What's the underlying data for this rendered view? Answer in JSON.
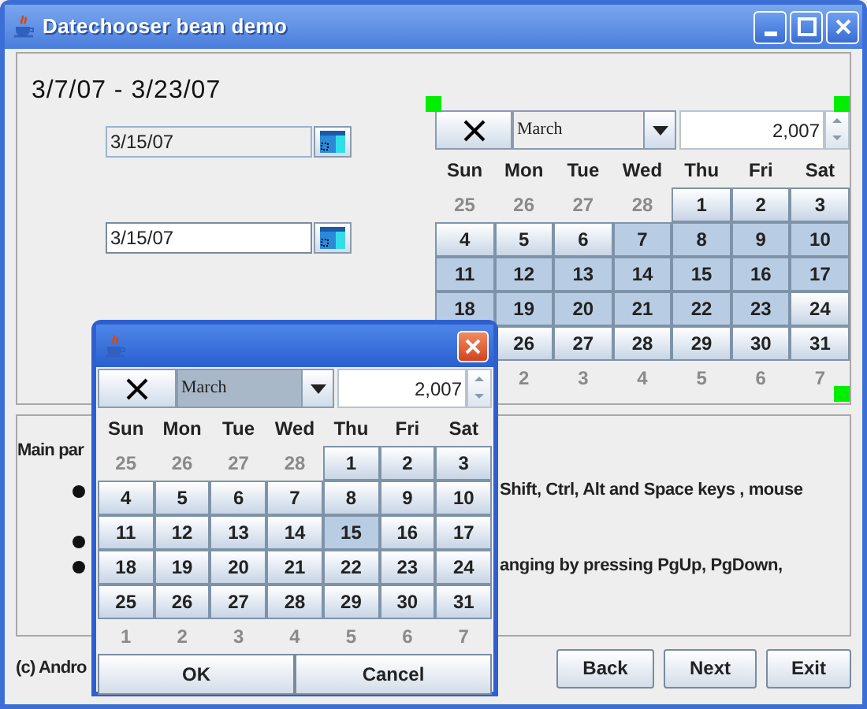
{
  "window": {
    "title": "Datechooser bean demo"
  },
  "range_label": "3/7/07 - 3/23/07",
  "date_fields": [
    {
      "value": "3/15/07",
      "disabled": true
    },
    {
      "value": "3/15/07",
      "disabled": false
    }
  ],
  "calendar": {
    "month": "March",
    "month_selected": false,
    "year": "2,007",
    "weekdays": [
      "Sun",
      "Mon",
      "Tue",
      "Wed",
      "Thu",
      "Fri",
      "Sat"
    ],
    "days": [
      {
        "label": "25",
        "kind": "other"
      },
      {
        "label": "26",
        "kind": "other"
      },
      {
        "label": "27",
        "kind": "other"
      },
      {
        "label": "28",
        "kind": "other"
      },
      {
        "label": "1",
        "kind": "day",
        "selected": false
      },
      {
        "label": "2",
        "kind": "day",
        "selected": false
      },
      {
        "label": "3",
        "kind": "day",
        "selected": false
      },
      {
        "label": "4",
        "kind": "day",
        "selected": false
      },
      {
        "label": "5",
        "kind": "day",
        "selected": false
      },
      {
        "label": "6",
        "kind": "day",
        "selected": false
      },
      {
        "label": "7",
        "kind": "day",
        "selected": true
      },
      {
        "label": "8",
        "kind": "day",
        "selected": true
      },
      {
        "label": "9",
        "kind": "day",
        "selected": true
      },
      {
        "label": "10",
        "kind": "day",
        "selected": true
      },
      {
        "label": "11",
        "kind": "day",
        "selected": true
      },
      {
        "label": "12",
        "kind": "day",
        "selected": true
      },
      {
        "label": "13",
        "kind": "day",
        "selected": true
      },
      {
        "label": "14",
        "kind": "day",
        "selected": true
      },
      {
        "label": "15",
        "kind": "day",
        "selected": true
      },
      {
        "label": "16",
        "kind": "day",
        "selected": true
      },
      {
        "label": "17",
        "kind": "day",
        "selected": true
      },
      {
        "label": "18",
        "kind": "day",
        "selected": true
      },
      {
        "label": "19",
        "kind": "day",
        "selected": true
      },
      {
        "label": "20",
        "kind": "day",
        "selected": true
      },
      {
        "label": "21",
        "kind": "day",
        "selected": true
      },
      {
        "label": "22",
        "kind": "day",
        "selected": true
      },
      {
        "label": "23",
        "kind": "day",
        "selected": true
      },
      {
        "label": "24",
        "kind": "day",
        "selected": false
      },
      {
        "kind": "covered"
      },
      {
        "label": "26",
        "kind": "day",
        "selected": false
      },
      {
        "label": "27",
        "kind": "day",
        "selected": false
      },
      {
        "label": "28",
        "kind": "day",
        "selected": false
      },
      {
        "label": "29",
        "kind": "day",
        "selected": false
      },
      {
        "label": "30",
        "kind": "day",
        "selected": false
      },
      {
        "label": "31",
        "kind": "day",
        "selected": false
      },
      {
        "kind": "covered"
      },
      {
        "label": "2",
        "kind": "other"
      },
      {
        "label": "3",
        "kind": "other"
      },
      {
        "label": "4",
        "kind": "other"
      },
      {
        "label": "5",
        "kind": "other"
      },
      {
        "label": "6",
        "kind": "other"
      },
      {
        "label": "7",
        "kind": "other"
      }
    ]
  },
  "info_panel": {
    "heading": "Main par",
    "bullets": [
      {
        "kind": "bullet",
        "text": "Shift, Ctrl, Alt and Space keys , mouse"
      },
      {
        "kind": "bullet"
      },
      {
        "kind": "bullet",
        "text": "anging by pressing PgUp, PgDown,"
      }
    ]
  },
  "footer": {
    "text": "(c) Andro",
    "buttons": [
      "Back",
      "Next",
      "Exit"
    ]
  },
  "popup": {
    "calendar": {
      "month": "March",
      "month_selected": true,
      "year": "2,007",
      "weekdays": [
        "Sun",
        "Mon",
        "Tue",
        "Wed",
        "Thu",
        "Fri",
        "Sat"
      ],
      "days": [
        {
          "label": "25",
          "kind": "other"
        },
        {
          "label": "26",
          "kind": "other"
        },
        {
          "label": "27",
          "kind": "other"
        },
        {
          "label": "28",
          "kind": "other"
        },
        {
          "label": "1",
          "kind": "day",
          "selected": false
        },
        {
          "label": "2",
          "kind": "day",
          "selected": false
        },
        {
          "label": "3",
          "kind": "day",
          "selected": false
        },
        {
          "label": "4",
          "kind": "day",
          "selected": false
        },
        {
          "label": "5",
          "kind": "day",
          "selected": false
        },
        {
          "label": "6",
          "kind": "day",
          "selected": false
        },
        {
          "label": "7",
          "kind": "day",
          "selected": false
        },
        {
          "label": "8",
          "kind": "day",
          "selected": false
        },
        {
          "label": "9",
          "kind": "day",
          "selected": false
        },
        {
          "label": "10",
          "kind": "day",
          "selected": false
        },
        {
          "label": "11",
          "kind": "day",
          "selected": false
        },
        {
          "label": "12",
          "kind": "day",
          "selected": false
        },
        {
          "label": "13",
          "kind": "day",
          "selected": false
        },
        {
          "label": "14",
          "kind": "day",
          "selected": false
        },
        {
          "label": "15",
          "kind": "day",
          "selected": true
        },
        {
          "label": "16",
          "kind": "day",
          "selected": false
        },
        {
          "label": "17",
          "kind": "day",
          "selected": false
        },
        {
          "label": "18",
          "kind": "day",
          "selected": false
        },
        {
          "label": "19",
          "kind": "day",
          "selected": false
        },
        {
          "label": "20",
          "kind": "day",
          "selected": false
        },
        {
          "label": "21",
          "kind": "day",
          "selected": false
        },
        {
          "label": "22",
          "kind": "day",
          "selected": false
        },
        {
          "label": "23",
          "kind": "day",
          "selected": false
        },
        {
          "label": "24",
          "kind": "day",
          "selected": false
        },
        {
          "label": "25",
          "kind": "day",
          "selected": false
        },
        {
          "label": "26",
          "kind": "day",
          "selected": false
        },
        {
          "label": "27",
          "kind": "day",
          "selected": false
        },
        {
          "label": "28",
          "kind": "day",
          "selected": false
        },
        {
          "label": "29",
          "kind": "day",
          "selected": false
        },
        {
          "label": "30",
          "kind": "day",
          "selected": false
        },
        {
          "label": "31",
          "kind": "day",
          "selected": false
        },
        {
          "label": "1",
          "kind": "other"
        },
        {
          "label": "2",
          "kind": "other"
        },
        {
          "label": "3",
          "kind": "other"
        },
        {
          "label": "4",
          "kind": "other"
        },
        {
          "label": "5",
          "kind": "other"
        },
        {
          "label": "6",
          "kind": "other"
        },
        {
          "label": "7",
          "kind": "other"
        }
      ]
    },
    "buttons": [
      "OK",
      "Cancel"
    ]
  }
}
